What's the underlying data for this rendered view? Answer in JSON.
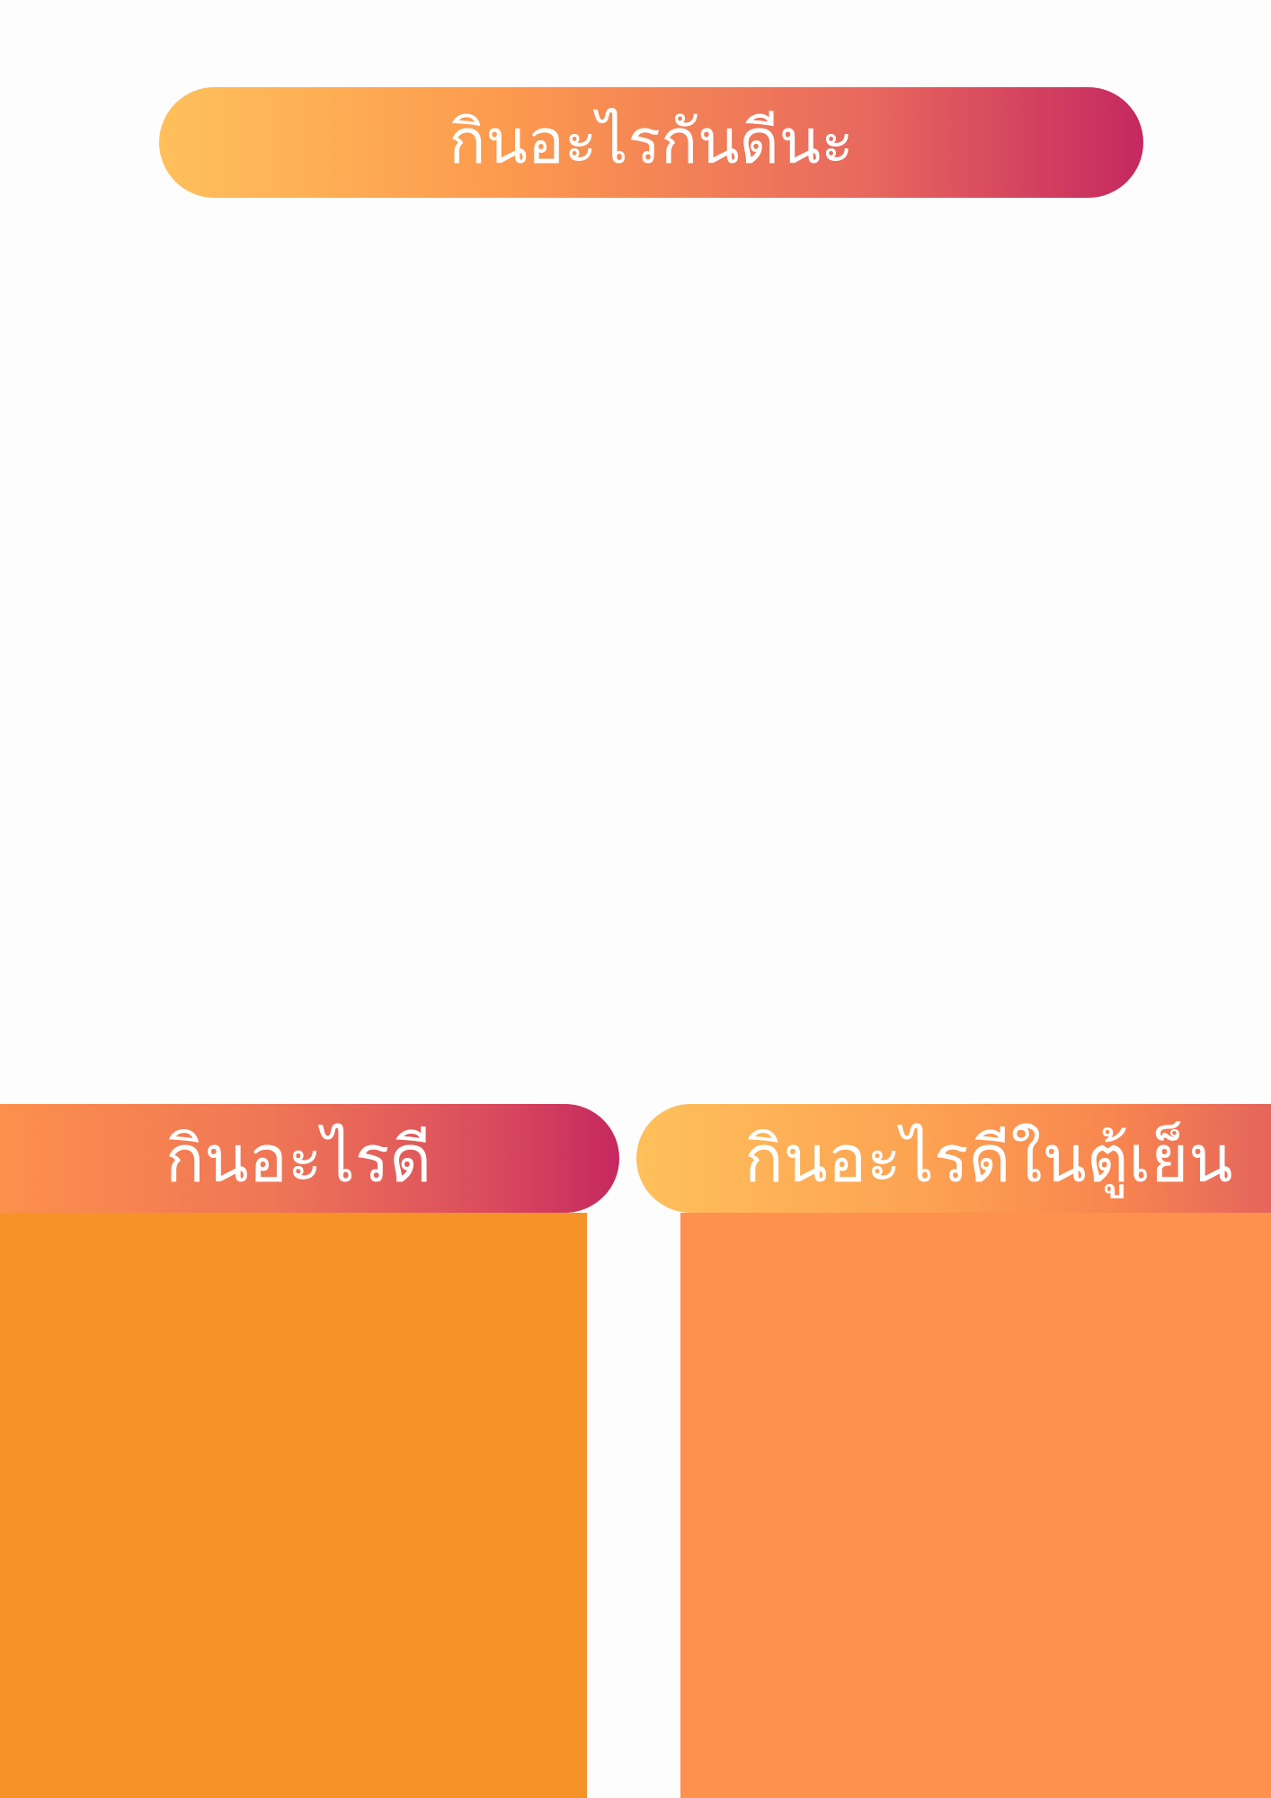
{
  "header": {
    "title": "กินอะไรกันดีนะ"
  },
  "columns": [
    {
      "label": "กินอะไรดี"
    },
    {
      "label": "กินอะไรดีในตู้เย็น"
    }
  ],
  "colors": {
    "background": "#fdfdfd",
    "gradient_start": "#fec05b",
    "gradient_mid": "#fd9a4e",
    "gradient_end": "#c5285f",
    "left_panel": "#f69328",
    "right_panel": "#fe914e",
    "text": "#ffffff"
  }
}
